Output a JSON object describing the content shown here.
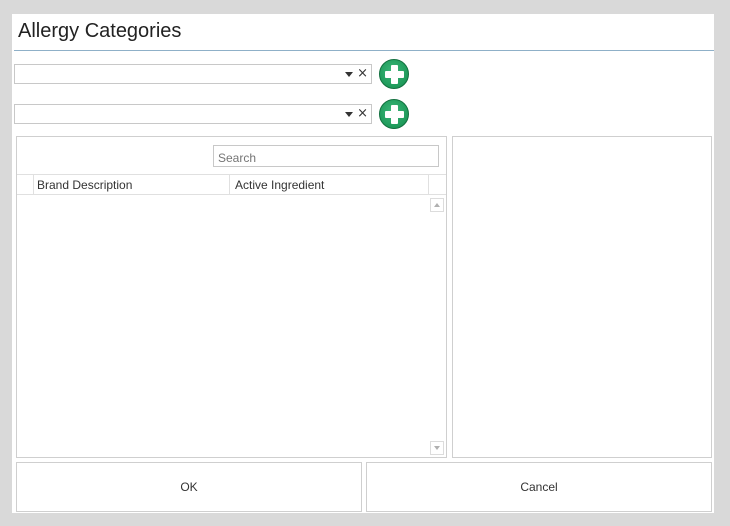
{
  "dialog": {
    "title": "Allergy Categories"
  },
  "selectors": [
    {
      "value": "",
      "clear_glyph": "×",
      "icon": "chevron-down-icon"
    },
    {
      "value": "",
      "clear_glyph": "×",
      "icon": "chevron-down-icon"
    }
  ],
  "add_button": {
    "icon": "plus-circle-icon",
    "color": "#1e9a5a"
  },
  "search": {
    "placeholder": "Search",
    "value": ""
  },
  "grid": {
    "columns": [
      "Brand Description",
      "Active Ingredient"
    ],
    "rows": []
  },
  "buttons": {
    "ok_label": "OK",
    "cancel_label": "Cancel"
  },
  "colors": {
    "accent_line": "#8fb0c8",
    "add_green": "#1e9a5a",
    "window_bg": "#d9d9d9"
  }
}
